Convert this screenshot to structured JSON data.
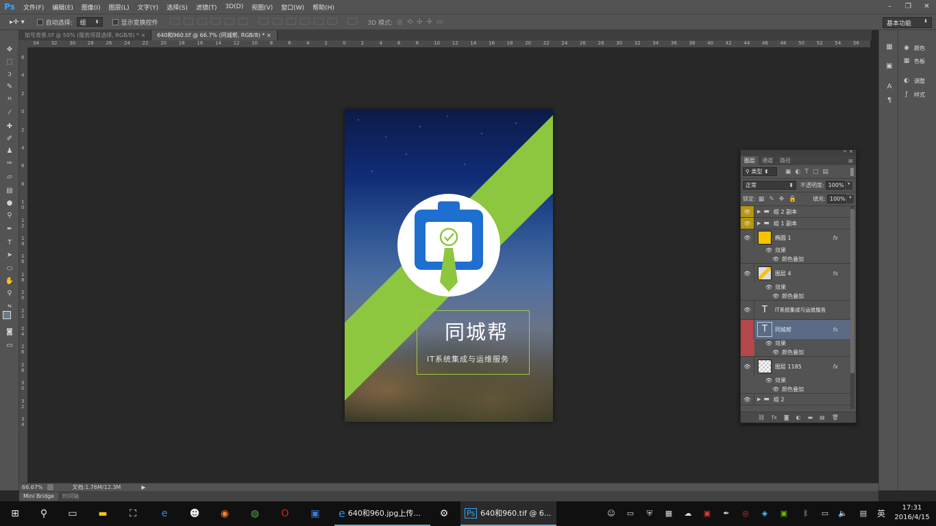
{
  "app": {
    "logo": "Ps"
  },
  "menu": [
    "文件(F)",
    "编辑(E)",
    "图像(I)",
    "图层(L)",
    "文字(Y)",
    "选择(S)",
    "滤镜(T)",
    "3D(D)",
    "视图(V)",
    "窗口(W)",
    "帮助(H)"
  ],
  "options": {
    "auto_select_label": "自动选择:",
    "auto_select_value": "组",
    "show_transform_label": "显示变换控件",
    "mode_3d_label": "3D 模式:",
    "workspace": "基本功能"
  },
  "tabs": [
    {
      "label": "加号背景.tif @ 50% (服务项目选择, RGB/8) *",
      "close": "×"
    },
    {
      "label": "640和960.tif @ 66.7% (同城帮, RGB/8) *",
      "close": "×"
    }
  ],
  "ruler_h": [
    "34",
    "32",
    "30",
    "28",
    "26",
    "24",
    "22",
    "20",
    "18",
    "16",
    "14",
    "12",
    "10",
    "8",
    "6",
    "4",
    "2",
    "0",
    "2",
    "4",
    "6",
    "8",
    "10",
    "12",
    "14",
    "16",
    "18",
    "20",
    "22",
    "24",
    "26",
    "28",
    "30",
    "32",
    "34",
    "36",
    "38",
    "40",
    "42",
    "44",
    "46",
    "48",
    "50",
    "52",
    "54",
    "56"
  ],
  "ruler_v": [
    "6",
    "4",
    "2",
    "0",
    "2",
    "4",
    "6",
    "8",
    "1 0",
    "1 2",
    "1 4",
    "1 6",
    "1 8",
    "2 0",
    "2 2",
    "2 4",
    "2 6",
    "2 8",
    "3 0",
    "3 2",
    "3 4"
  ],
  "artboard": {
    "title": "同城帮",
    "subtitle": "IT系统集成与运维服务",
    "colors": {
      "stripe": "#8dc63f",
      "logo_blue": "#1e6fcf",
      "circle": "#ffffff"
    }
  },
  "right_panels": [
    {
      "icon": "palette-icon",
      "label": "颜色"
    },
    {
      "icon": "swatches-icon",
      "label": "色板"
    },
    {
      "icon": "adjustments-icon",
      "label": "调整"
    },
    {
      "icon": "styles-icon",
      "label": "样式"
    }
  ],
  "layers_panel": {
    "tabs": [
      "图层",
      "通道",
      "路径"
    ],
    "filter_kind": "类型",
    "blend_mode": "正常",
    "opacity_label": "不透明度:",
    "opacity": "100%",
    "lock_label": "锁定:",
    "fill_label": "填充:",
    "fill": "100%",
    "layers": [
      {
        "name": "组 2 副本",
        "type": "group",
        "eye_color": "#b8960e"
      },
      {
        "name": "组 1 副本",
        "type": "group",
        "eye_color": "#b8960e"
      },
      {
        "name": "椭圆 1",
        "type": "shape",
        "fx": "fx",
        "effects_label": "效果",
        "effect": "颜色叠加"
      },
      {
        "name": "图层 4",
        "type": "pixel",
        "fx": "fx",
        "effects_label": "效果",
        "effect": "颜色叠加"
      },
      {
        "name": "IT系统集成与运维服务",
        "type": "text"
      },
      {
        "name": "同城帮",
        "type": "text",
        "fx": "fx",
        "effects_label": "效果",
        "effect": "颜色叠加",
        "selected": true,
        "eye_color": "#b5474a"
      },
      {
        "name": "图层 1185",
        "type": "pixel",
        "fx": "fx",
        "effects_label": "效果",
        "effect": "颜色叠加"
      },
      {
        "name": "组 2",
        "type": "group"
      }
    ]
  },
  "status": {
    "zoom": "66.67%",
    "doc_info": "文档:1.76M/12.3M"
  },
  "bottom_tabs": [
    "Mini Bridge",
    "时间轴"
  ],
  "taskbar": {
    "windows": [
      {
        "label": "640和960.jpg上传...",
        "icon": "ie-icon"
      },
      {
        "label": "640和960.tif @ 6...",
        "icon": "ps-icon"
      }
    ],
    "ime": "英",
    "time": "17:31",
    "date": "2016/4/15"
  }
}
